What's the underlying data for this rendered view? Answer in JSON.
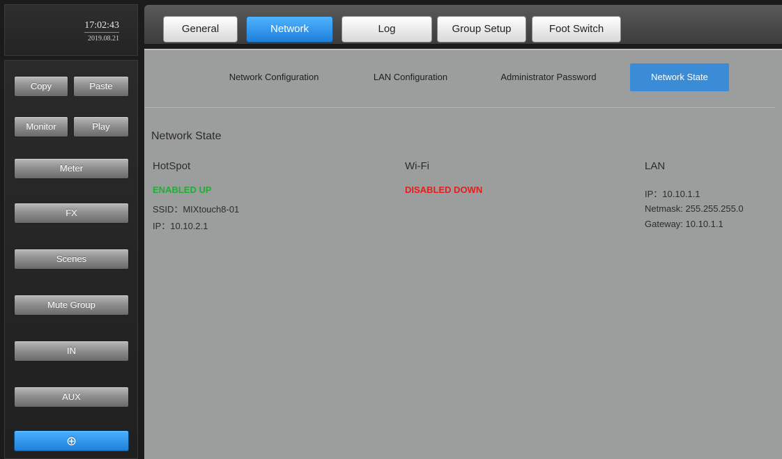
{
  "clock": {
    "time": "17:02:43",
    "date": "2019.08.21"
  },
  "sidebar": {
    "copy": "Copy",
    "paste": "Paste",
    "monitor": "Monitor",
    "play": "Play",
    "meter": "Meter",
    "fx": "FX",
    "scenes": "Scenes",
    "mute_group": "Mute Group",
    "in": "IN",
    "aux": "AUX",
    "bottom_icon": "globe-icon",
    "bottom_glyph": "⊕"
  },
  "tabs": {
    "general": "General",
    "network": "Network",
    "log": "Log",
    "group_setup": "Group Setup",
    "foot_switch": "Foot Switch",
    "active": "Network"
  },
  "subtabs": {
    "network_configuration": "Network Configuration",
    "lan_configuration": "LAN Configuration",
    "administrator_password": "Administrator Password",
    "network_state": "Network State",
    "active": "Network State"
  },
  "network_state": {
    "title": "Network State",
    "hotspot": {
      "title": "HotSpot",
      "status": "ENABLED UP",
      "ssid": "SSID：MIXtouch8-01",
      "ip": "IP：10.10.2.1"
    },
    "wifi": {
      "title": "Wi-Fi",
      "status": "DISABLED DOWN"
    },
    "lan": {
      "title": "LAN",
      "ip": "IP：10.10.1.1",
      "netmask": "Netmask: 255.255.255.0",
      "gateway": "Gateway: 10.10.1.1"
    }
  },
  "colors": {
    "active_blue": "#3a8cd6",
    "status_up": "#1fae35",
    "status_down": "#e21e1e",
    "panel_bg": "#9c9d9d"
  }
}
